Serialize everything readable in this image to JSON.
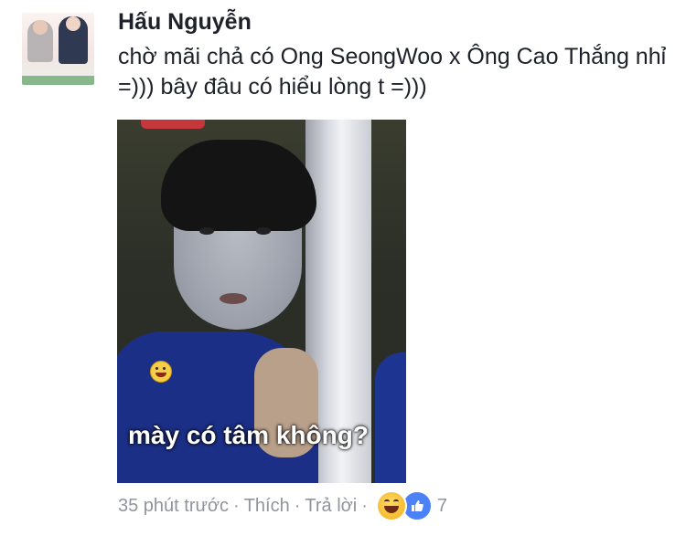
{
  "comment": {
    "author": "Hấu Nguyễn",
    "text": "chờ mãi chả có Ong SeongWoo x Ông Cao Thắng nhỉ =))) bây đâu có hiểu lòng t =)))"
  },
  "photo": {
    "caption": "mày có tâm không?"
  },
  "meta": {
    "time": "35 phút trước",
    "separator": "·",
    "like_label": "Thích",
    "reply_label": "Trả lời",
    "reaction_count": "7",
    "reaction_icons": [
      "haha-icon",
      "like-icon"
    ]
  },
  "colors": {
    "text": "#1d2129",
    "meta": "#90949c",
    "like_blue": "#4c82f7",
    "haha_yellow": "#f4b82b"
  }
}
